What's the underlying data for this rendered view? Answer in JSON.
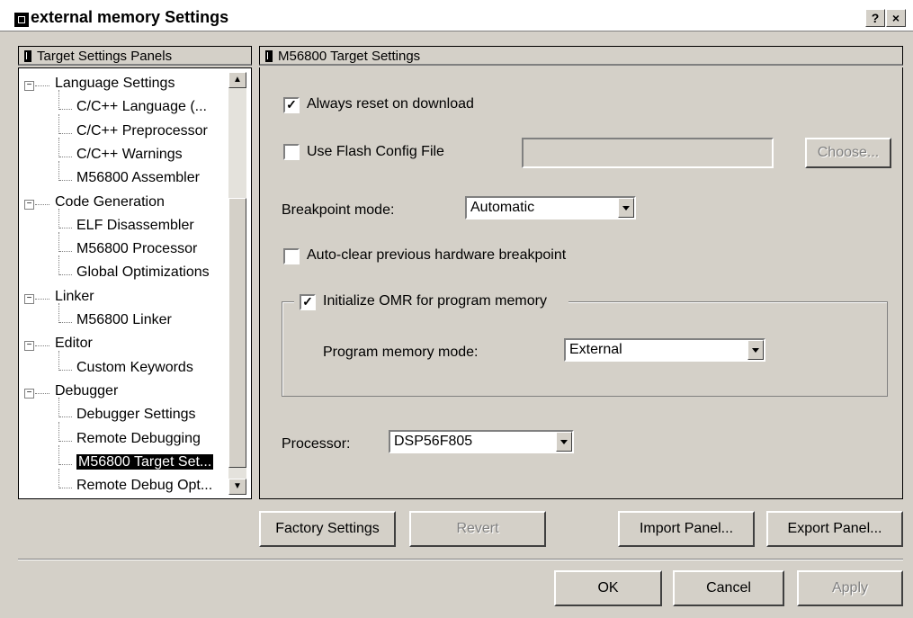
{
  "window": {
    "title": "external memory Settings",
    "help_label": "?",
    "close_label": "×"
  },
  "tree_panel": {
    "header": "Target Settings Panels",
    "items": [
      {
        "label": "Language Settings",
        "level": 0
      },
      {
        "label": "C/C++ Language (...",
        "level": 1
      },
      {
        "label": "C/C++ Preprocessor",
        "level": 1
      },
      {
        "label": "C/C++ Warnings",
        "level": 1
      },
      {
        "label": "M56800 Assembler",
        "level": 1
      },
      {
        "label": "Code Generation",
        "level": 0
      },
      {
        "label": "ELF Disassembler",
        "level": 1
      },
      {
        "label": "M56800 Processor",
        "level": 1
      },
      {
        "label": "Global Optimizations",
        "level": 1
      },
      {
        "label": "Linker",
        "level": 0
      },
      {
        "label": "M56800 Linker",
        "level": 1
      },
      {
        "label": "Editor",
        "level": 0
      },
      {
        "label": "Custom Keywords",
        "level": 1
      },
      {
        "label": "Debugger",
        "level": 0
      },
      {
        "label": "Debugger Settings",
        "level": 1
      },
      {
        "label": "Remote Debugging",
        "level": 1
      },
      {
        "label": "M56800 Target Set...",
        "level": 1
      },
      {
        "label": "Remote Debug Opt...",
        "level": 1
      }
    ],
    "collapse_glyph": "−"
  },
  "settings": {
    "header": "M56800 Target Settings",
    "always_reset": {
      "label": "Always reset on download",
      "checked": true
    },
    "use_flash": {
      "label": "Use Flash Config File",
      "checked": false,
      "value": ""
    },
    "choose_label": "Choose...",
    "breakpoint_mode": {
      "label": "Breakpoint mode:",
      "value": "Automatic"
    },
    "auto_clear": {
      "label": "Auto-clear previous hardware breakpoint",
      "checked": false
    },
    "init_omr": {
      "label": "Initialize OMR for program memory",
      "checked": true
    },
    "program_memory_mode": {
      "label": "Program memory mode:",
      "value": "External"
    },
    "processor": {
      "label": "Processor:",
      "value": "DSP56F805"
    },
    "check_glyph": "✓"
  },
  "buttons": {
    "factory": "Factory Settings",
    "revert": "Revert",
    "import": "Import Panel...",
    "export": "Export Panel...",
    "ok": "OK",
    "cancel": "Cancel",
    "apply": "Apply"
  }
}
